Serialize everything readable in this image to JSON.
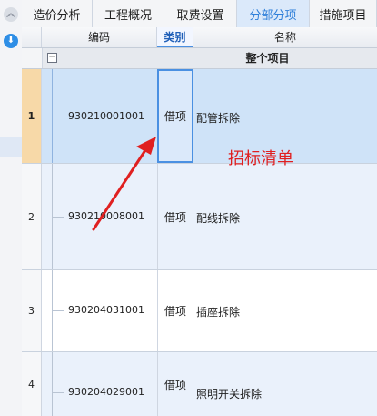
{
  "tabs": [
    "造价分析",
    "工程概况",
    "取费设置",
    "分部分项",
    "措施项目"
  ],
  "active_tab": "分部分项",
  "columns": {
    "code": "编码",
    "category": "类别",
    "name": "名称"
  },
  "group": {
    "toggle": "−",
    "title": "整个项目"
  },
  "rows": [
    {
      "num": "1",
      "code": "930210001001",
      "category": "借项",
      "name": "配管拆除"
    },
    {
      "num": "2",
      "code": "930210008001",
      "category": "借项",
      "name": "配线拆除"
    },
    {
      "num": "3",
      "code": "930204031001",
      "category": "借项",
      "name": "插座拆除"
    },
    {
      "num": "4",
      "code": "930204029001",
      "category": "借项",
      "name": "照明开关拆除"
    }
  ],
  "annotation": "招标清单",
  "colors": {
    "accent": "#2e7fd9",
    "annotation": "#e02020",
    "selected_row": "#cfe3f8",
    "row_alt": "#eaf1fb"
  }
}
